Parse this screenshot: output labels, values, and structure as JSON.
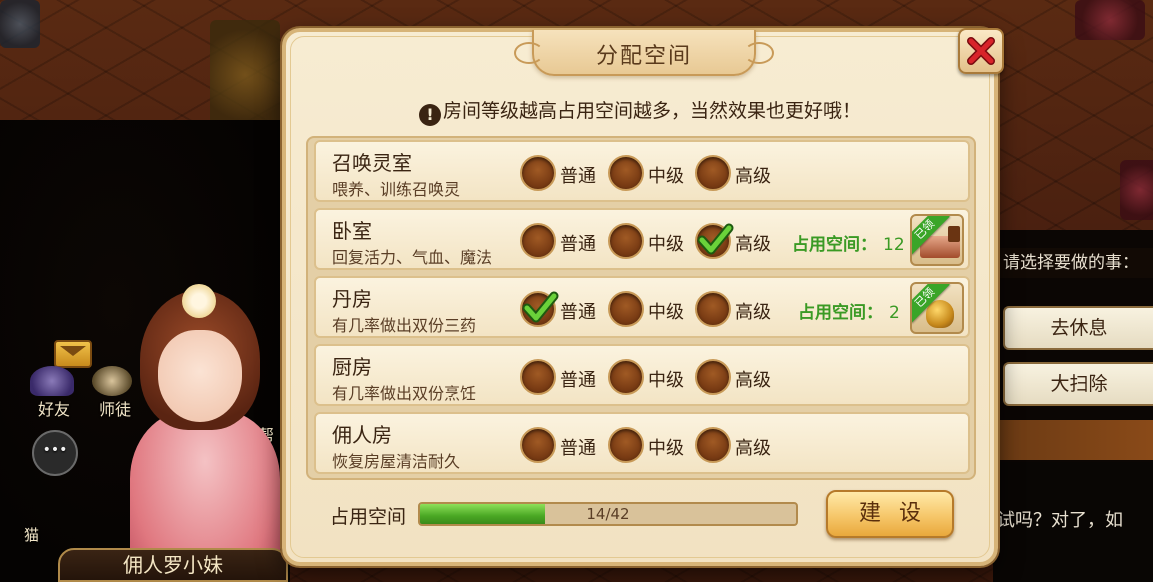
{
  "modal": {
    "title": "分配空间",
    "notice": "房间等级越高占用空间越多，当然效果也更好哦！",
    "rooms": [
      {
        "name": "召唤灵室",
        "desc": "喂养、训练召唤灵",
        "selected": null,
        "space_label": "",
        "space_value": "",
        "item_icon": ""
      },
      {
        "name": "卧室",
        "desc": "回复活力、气血、魔法",
        "selected": "高级",
        "space_label": "占用空间：",
        "space_value": "12",
        "item_icon": "bed-icon"
      },
      {
        "name": "丹房",
        "desc": "有几率做出双份三药",
        "selected": "普通",
        "space_label": "占用空间：",
        "space_value": "2",
        "item_icon": "alchemy-pot-icon"
      },
      {
        "name": "厨房",
        "desc": "有几率做出双份烹饪",
        "selected": null,
        "space_label": "",
        "space_value": "",
        "item_icon": ""
      },
      {
        "name": "佣人房",
        "desc": "恢复房屋清洁耐久",
        "selected": null,
        "space_label": "",
        "space_value": "",
        "item_icon": ""
      }
    ],
    "levels": [
      "普通",
      "中级",
      "高级"
    ],
    "owned_badge": "已领",
    "usage": {
      "label": "占用空间",
      "text": "14/42",
      "used": 14,
      "total": 42
    },
    "build_button": "建设"
  },
  "background": {
    "prompt": "请选择要做的事：",
    "choices": [
      "去休息",
      "大扫除"
    ],
    "dialog_text": "试吗？对了，如",
    "npc_name": "佣人罗小妹",
    "hud": {
      "friends": "好友",
      "master": "师徒",
      "cat": "猫",
      "help": "帮"
    }
  },
  "colors": {
    "accent_green": "#3a9a24",
    "progress_fill": "#4aa824",
    "panel_bg": "#f7ecd2",
    "close_red": "#d8232a"
  }
}
